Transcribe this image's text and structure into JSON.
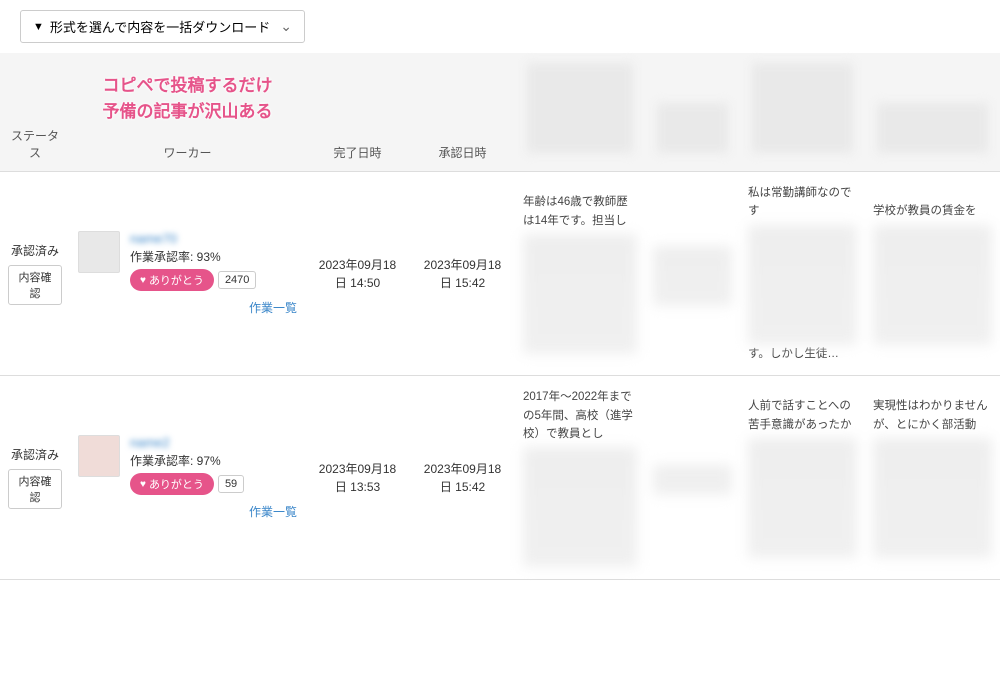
{
  "toolbar": {
    "download_label": "形式を選んで内容を一括ダウンロード"
  },
  "overlay": {
    "line1": "コピペで投稿するだけ",
    "line2": "予備の記事が沢山ある"
  },
  "headers": {
    "status": "ステータス",
    "worker": "ワーカー",
    "completed": "完了日時",
    "approved": "承認日時"
  },
  "thanks_label": "ありがとう",
  "work_list_label": "作業一覧",
  "confirm_label": "内容確認",
  "rows": [
    {
      "status": "承認済み",
      "approval_rate": "作業承認率: 93%",
      "thanks_count": "2470",
      "completed": "2023年09月18日 14:50",
      "approved": "2023年09月18日 15:42",
      "snippet_a": "年齢は46歳で教師歴は14年です。担当し",
      "snippet_b": "",
      "snippet_c": "私は常勤講師なのです",
      "snippet_c_end": "す。しかし生徒…",
      "snippet_d": "学校が教員の賃金を"
    },
    {
      "status": "承認済み",
      "approval_rate": "作業承認率: 97%",
      "thanks_count": "59",
      "completed": "2023年09月18日 13:53",
      "approved": "2023年09月18日 15:42",
      "snippet_a": "2017年〜2022年までの5年間、高校（進学校）で教員とし",
      "snippet_b": "",
      "snippet_c": "人前で話すことへの苦手意識があったか",
      "snippet_d": "実現性はわかりませんが、とにかく部活動"
    }
  ]
}
